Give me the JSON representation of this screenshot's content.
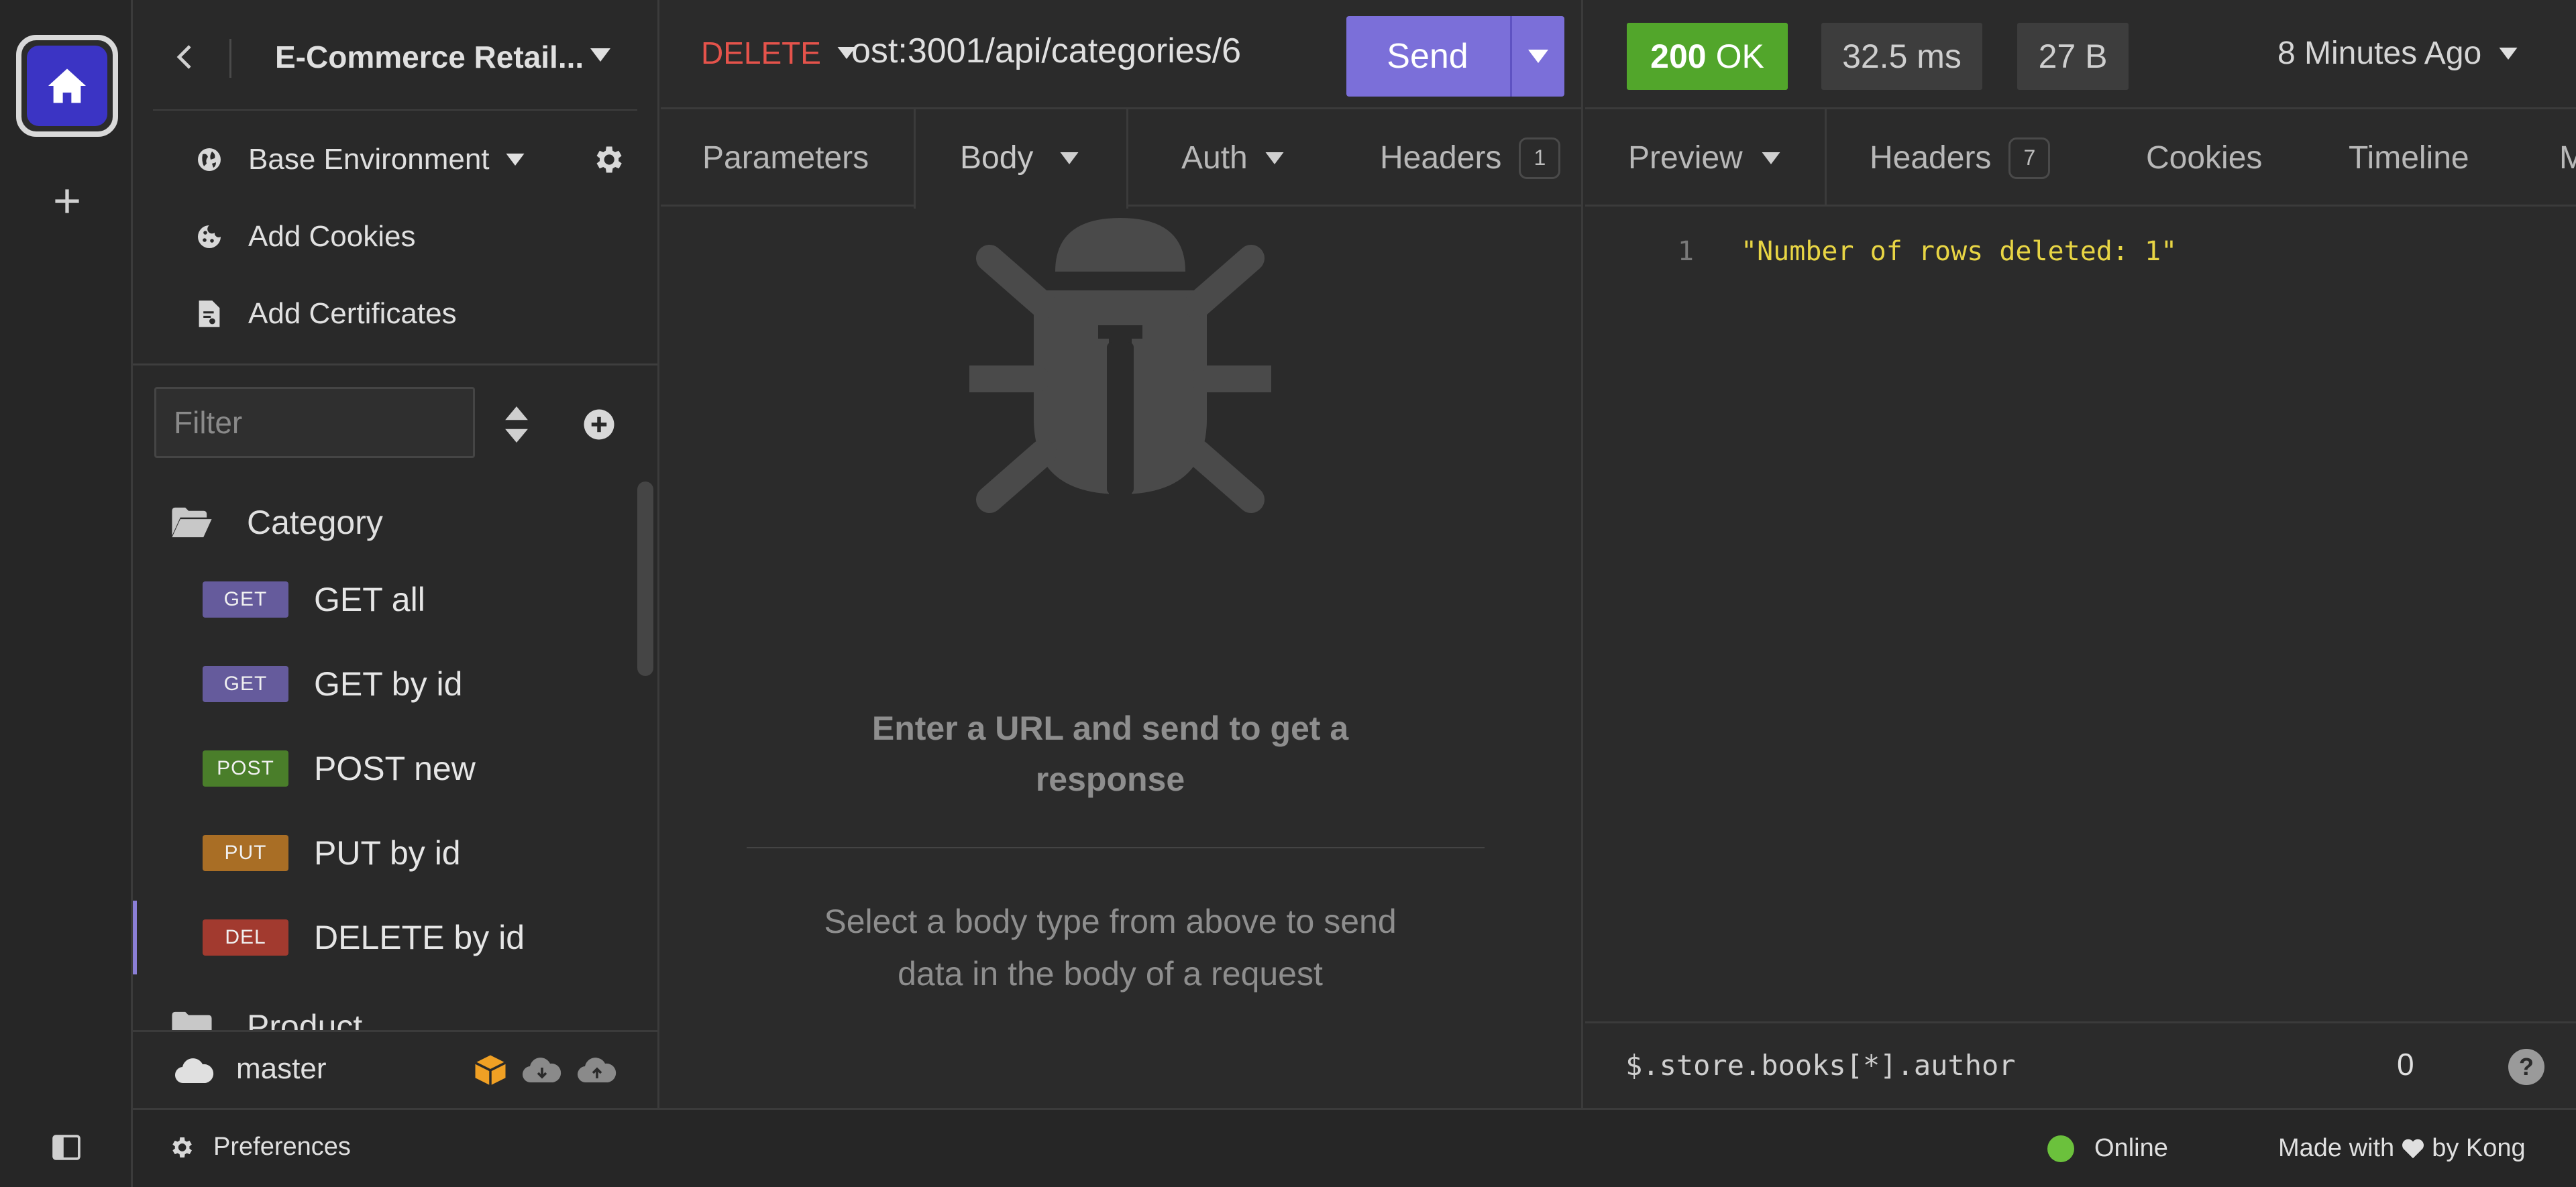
{
  "colors": {
    "accent": "#7b6fd9",
    "status_ok": "#52a62b",
    "method_delete": "#e5534b",
    "badge_get": "#655b9c",
    "badge_post": "#4a7e2a",
    "badge_put": "#a96e25",
    "badge_del": "#a23a2f",
    "response_string": "#e8d544"
  },
  "rail": {
    "home_icon": "home-icon",
    "add_icon": "plus-icon",
    "toggle_icon": "sidebar-toggle-icon"
  },
  "sidebar": {
    "project_title": "E-Commerce Retail...",
    "environment": "Base Environment",
    "add_cookies": "Add Cookies",
    "add_certificates": "Add Certificates",
    "filter_placeholder": "Filter",
    "folders": [
      {
        "name": "Category"
      },
      {
        "name": "Product"
      }
    ],
    "requests": [
      {
        "method": "GET",
        "label": "GET all"
      },
      {
        "method": "GET",
        "label": "GET by id"
      },
      {
        "method": "POST",
        "label": "POST new"
      },
      {
        "method": "PUT",
        "label": "PUT by id"
      },
      {
        "method": "DEL",
        "label": "DELETE by id",
        "active": true
      }
    ],
    "git_branch": "master"
  },
  "request": {
    "method": "DELETE",
    "url": "ost:3001/api/categories/6",
    "send_label": "Send",
    "tabs": {
      "parameters": "Parameters",
      "body": "Body",
      "auth": "Auth",
      "headers": "Headers",
      "headers_count": "1"
    },
    "empty_title": "Enter a URL and send to get a response",
    "empty_hint": "Select a body type from above to send data in the body of a request"
  },
  "response": {
    "status_code": "200",
    "status_text": "OK",
    "time": "32.5 ms",
    "size": "27 B",
    "time_ago": "8 Minutes Ago",
    "tabs": {
      "preview": "Preview",
      "headers": "Headers",
      "headers_count": "7",
      "cookies": "Cookies",
      "timeline": "Timeline",
      "more": "M"
    },
    "line_number": "1",
    "body": "\"Number of rows deleted: 1\"",
    "jsonpath": "$.store.books[*].author",
    "jsonpath_count": "0",
    "help": "?"
  },
  "footer": {
    "preferences": "Preferences",
    "online": "Online",
    "made_with": "Made with",
    "by_kong": "by Kong"
  }
}
